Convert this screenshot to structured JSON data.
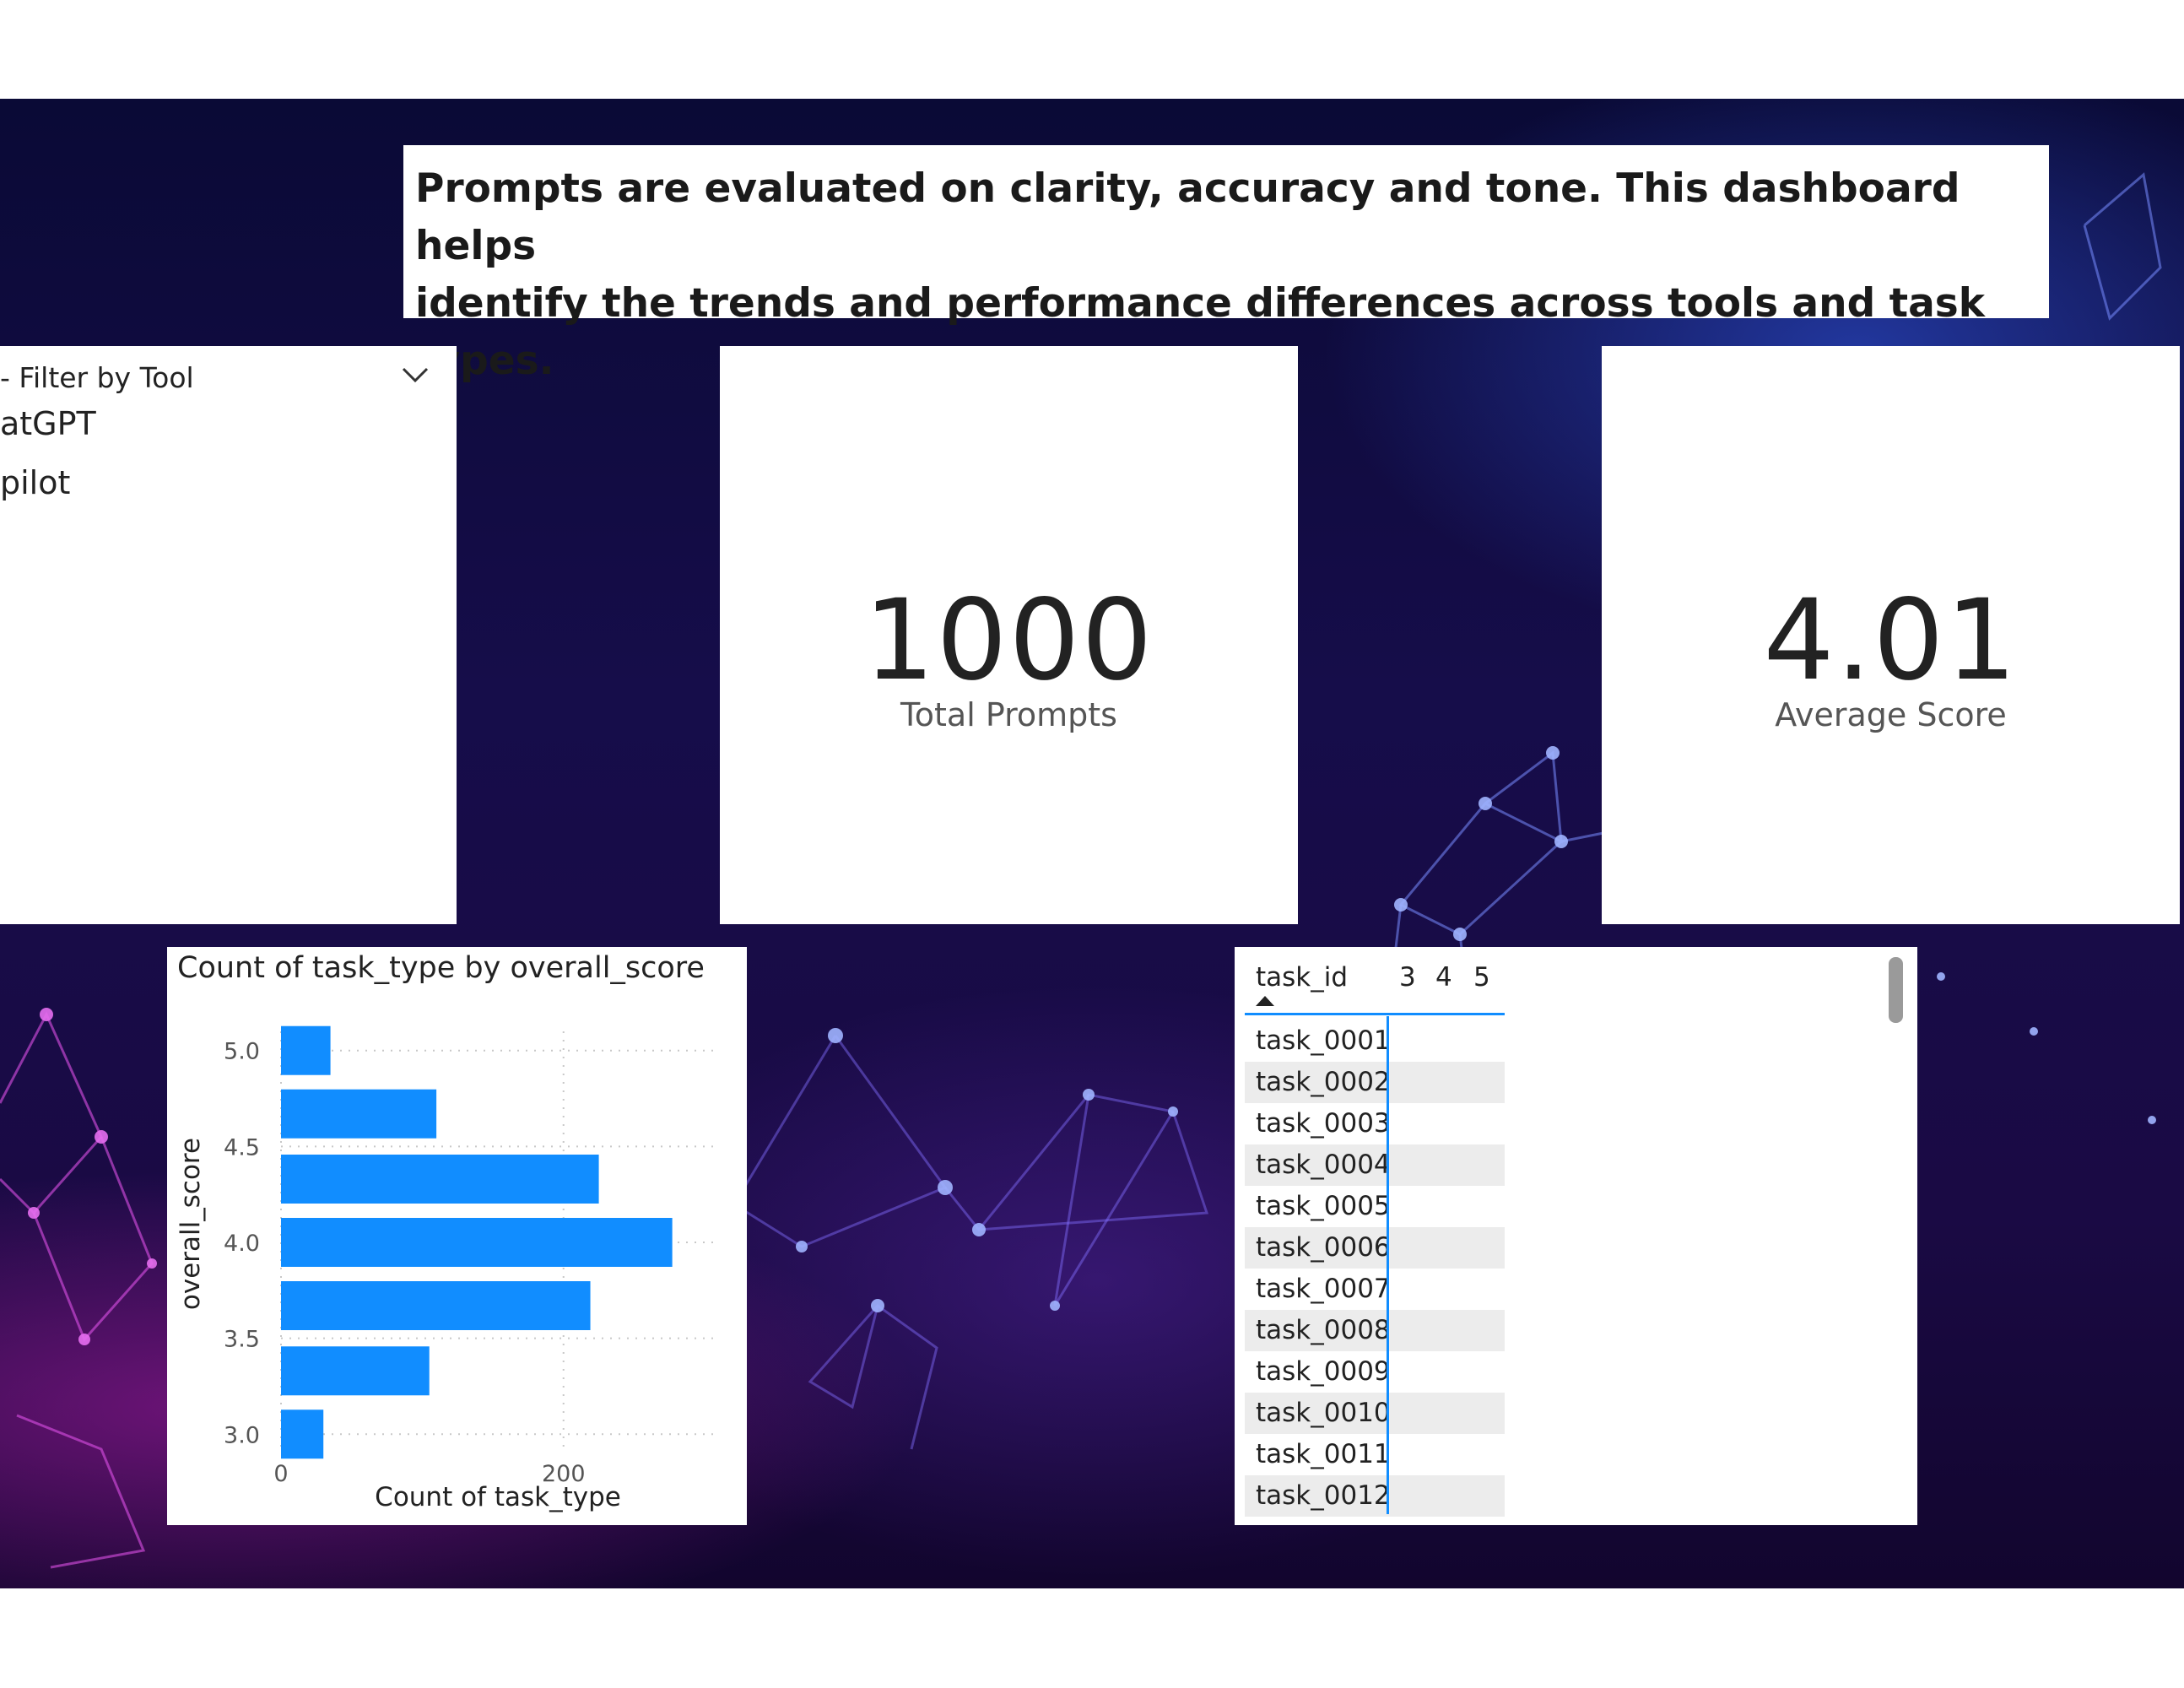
{
  "header": {
    "description_line1": "Prompts are evaluated on clarity, accuracy and tone. This dashboard helps",
    "description_line2": "identify the trends and performance differences across tools and task types."
  },
  "slicer": {
    "title": "- Filter by Tool",
    "options": [
      "atGPT",
      "pilot"
    ],
    "dropdown_icon": "chevron-down-icon"
  },
  "cards": {
    "total_prompts": {
      "value": "1000",
      "label": "Total Prompts"
    },
    "average_score": {
      "value": "4.01",
      "label": "Average Score"
    }
  },
  "chart_data": {
    "type": "bar",
    "orientation": "horizontal",
    "title": "Count of task_type by overall_score",
    "xlabel": "Count of task_type",
    "ylabel": "overall_score",
    "categories": [
      5.0,
      4.75,
      4.5,
      4.25,
      4.0,
      3.75,
      3.5,
      3.25,
      3.0
    ],
    "bars": [
      {
        "score": 5.0,
        "count": 35
      },
      {
        "score": 4.67,
        "count": 110
      },
      {
        "score": 4.33,
        "count": 225
      },
      {
        "score": 4.0,
        "count": 277
      },
      {
        "score": 3.67,
        "count": 219
      },
      {
        "score": 3.33,
        "count": 105
      },
      {
        "score": 3.0,
        "count": 30
      }
    ],
    "y_ticks": [
      "5.0",
      "4.5",
      "4.0",
      "3.5",
      "3.0"
    ],
    "x_ticks": [
      "0",
      "200"
    ],
    "xlim": [
      0,
      300
    ],
    "ylim": [
      2.9,
      5.1
    ],
    "bar_color": "#118dff",
    "grid": true
  },
  "table": {
    "columns": [
      "task_id",
      "3",
      "4",
      "5"
    ],
    "sort_indicator": "sort-ascending-icon",
    "rows": [
      "task_0001",
      "task_0002",
      "task_0003",
      "task_0004",
      "task_0005",
      "task_0006",
      "task_0007",
      "task_0008",
      "task_0009",
      "task_0010",
      "task_0011",
      "task_0012"
    ]
  },
  "colors": {
    "accent": "#118dff",
    "background_dark": "#0f0b3e"
  }
}
